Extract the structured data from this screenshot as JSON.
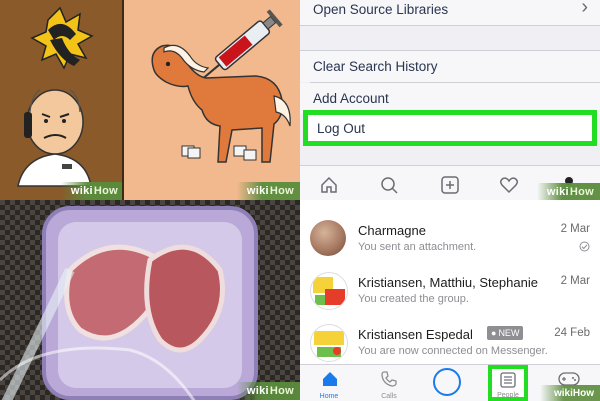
{
  "watermark": {
    "part1": "wiki",
    "part2": "How"
  },
  "settings": {
    "rows": [
      {
        "label": "Open Source Libraries",
        "has_chevron": true,
        "chevron": "›"
      },
      {
        "label": "Clear Search History"
      },
      {
        "label": "Add Account"
      },
      {
        "label": "Log Out",
        "highlighted": true
      }
    ],
    "highlight_color": "#22dd22",
    "tabbar_icons": [
      "home-icon",
      "search-icon",
      "plus-icon",
      "heart-icon",
      "profile-icon"
    ]
  },
  "messenger": {
    "chats": [
      {
        "name": "Charmagne",
        "preview": "You sent an attachment.",
        "date": "2 Mar",
        "status_icon": "sent-check-icon"
      },
      {
        "name": "Kristiansen, Matthiu, Stephanie",
        "preview": "You created the group.",
        "date": "2 Mar"
      },
      {
        "name": "Kristiansen Espedal",
        "badge": "NEW",
        "preview": "You are now connected on Messenger.",
        "date": "24 Feb"
      }
    ],
    "tabbar": [
      {
        "label": "Home",
        "icon": "home-icon",
        "active": true
      },
      {
        "label": "Calls",
        "icon": "phone-icon"
      },
      {
        "label": "",
        "icon": "camera-circle-icon"
      },
      {
        "label": "People",
        "icon": "people-list-icon",
        "highlighted": true
      },
      {
        "label": "",
        "icon": "gamepad-icon"
      }
    ],
    "accent": "#1a7bea"
  }
}
